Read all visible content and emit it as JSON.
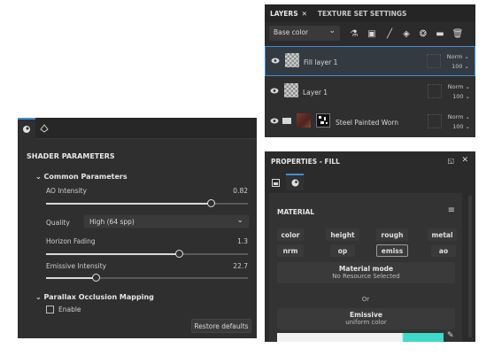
{
  "shader": {
    "title": "SHADER PARAMETERS",
    "common_group": "Common Parameters",
    "ao_label": "AO Intensity",
    "ao_value": "0.82",
    "ao_level": 0.82,
    "quality_label": "Quality",
    "quality_value": "High (64 spp)",
    "horizon_label": "Horizon Fading",
    "horizon_value": "1.3",
    "emissive_label": "Emissive Intensity",
    "emissive_value": "22.7",
    "parallax_group": "Parallax Occlusion Mapping",
    "enable_label": "Enable",
    "restore_label": "Restore defaults"
  },
  "layers": {
    "tab_layers": "LAYERS",
    "tab_texture": "TEXTURE SET SETTINGS",
    "channel": "Base color",
    "items": [
      {
        "name": "Fill layer 1",
        "blend": "Norm",
        "opacity": "100"
      },
      {
        "name": "Layer 1",
        "blend": "Norm",
        "opacity": "100"
      },
      {
        "name": "Steel Painted Worn",
        "blend": "Norm",
        "opacity": "100"
      }
    ]
  },
  "properties": {
    "title": "PROPERTIES - FILL",
    "material_label": "MATERIAL",
    "channels_row1": [
      "color",
      "height",
      "rough",
      "metal"
    ],
    "channels_row2": [
      "nrm",
      "op",
      "emiss",
      "ao"
    ],
    "mode_title": "Material mode",
    "mode_sub": "No Resource Selected",
    "or_label": "Or",
    "emissive_title": "Emissive",
    "emissive_sub": "uniform color"
  },
  "colors": {
    "accent": "#3d8fd6",
    "emissive_swatch": "#3fd9c6"
  }
}
